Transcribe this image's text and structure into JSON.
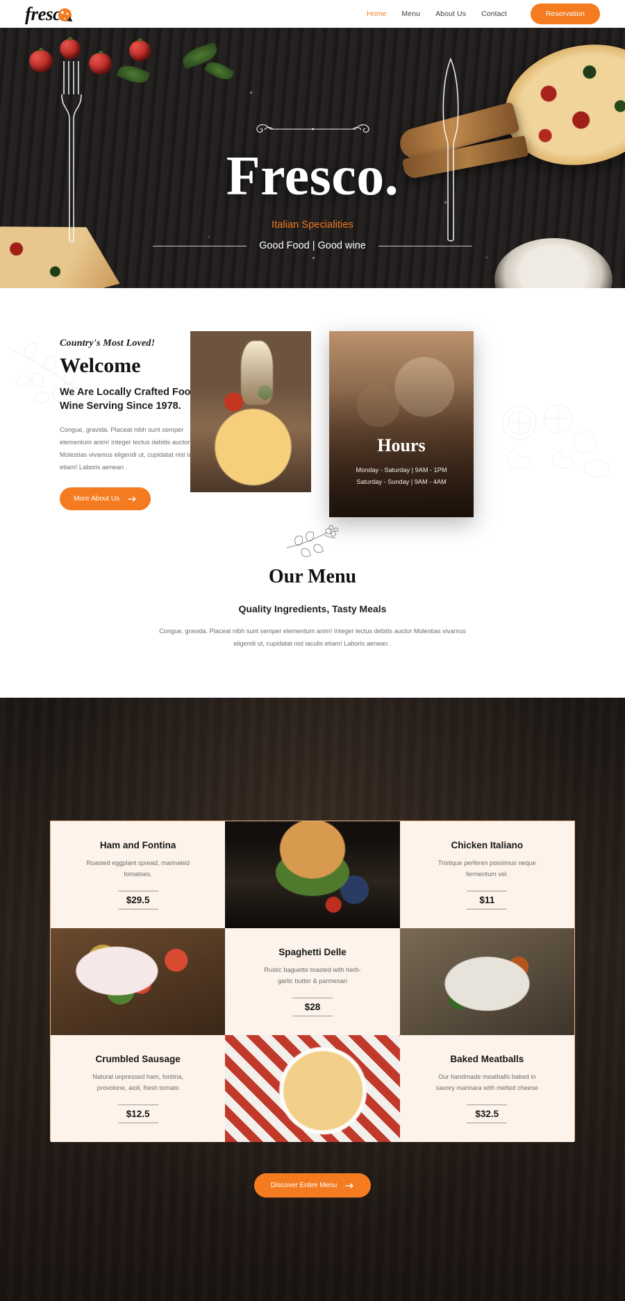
{
  "header": {
    "logo_text": "fresc",
    "logo_icon": "pizza-icon",
    "nav": [
      {
        "label": "Home",
        "active": true
      },
      {
        "label": "Menu",
        "active": false
      },
      {
        "label": "About Us",
        "active": false
      },
      {
        "label": "Contact",
        "active": false
      }
    ],
    "reservation_label": "Reservation"
  },
  "hero": {
    "title": "Fresco.",
    "subtitle": "Italian Specialities",
    "tagline": "Good Food | Good wine"
  },
  "welcome": {
    "eyebrow": "Country's Most Loved!",
    "heading": "Welcome",
    "lead": "We Are Locally Crafted Food & Wine Serving Since 1978.",
    "body": "Congue, gravida. Placeat nibh sunt semper elementum anim! Integer lectus debitis auctor Molestias vivamus eligendi ut, cupidatat nisl iaculis etiam! Laboris aenean .",
    "button_label": "More About Us"
  },
  "hours": {
    "title": "Hours",
    "lines": [
      "Monday - Saturday | 9AM - 1PM",
      "Saturday - Sunday | 9AM - 4AM"
    ]
  },
  "menu": {
    "heading": "Our Menu",
    "subheading": "Quality Ingredients, Tasty Meals",
    "description": "Congue, gravida. Placeat nibh sunt semper elementum anim! Integer lectus debitis auctor Molestias vivamus eligendi ut, cupidatat nisl iaculis etiam! Laboris aenean .",
    "discover_label": "Discover Entire Menu",
    "items": [
      {
        "name": "Ham and Fontina",
        "desc": "Roasted eggplant spread, marinated tomatoes.",
        "price": "$29.5"
      },
      {
        "name": "Chicken Italiano",
        "desc": "Tristique perferen possimus neque fermentum vel.",
        "price": "$11"
      },
      {
        "name": "Spaghetti Delle",
        "desc": "Rustic baguette toasted with herb-garlic butter & parmesan",
        "price": "$28"
      },
      {
        "name": "Crumbled Sausage",
        "desc": "Natural unpressed ham, fontina, provolone, aioli, fresh tomato",
        "price": "$12.5"
      },
      {
        "name": "Baked Meatballs",
        "desc": "Our handmade meatballs baked in savory marinara with melted cheese",
        "price": "$32.5"
      }
    ]
  },
  "colors": {
    "accent": "#f47b20",
    "card_bg": "#fdf3ea",
    "hero_bg": "#1d1b1a"
  }
}
